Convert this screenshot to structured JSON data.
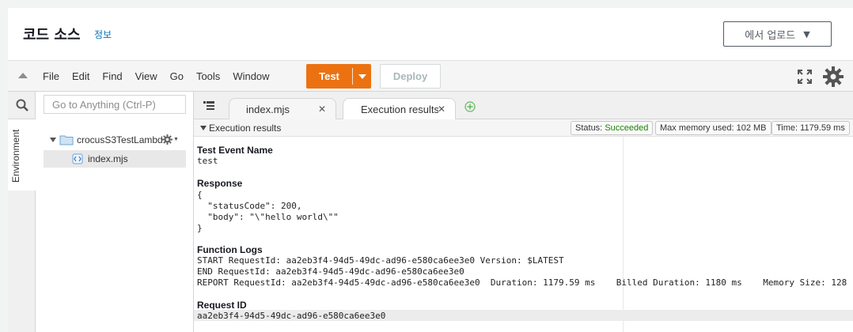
{
  "header": {
    "title": "코드 소스",
    "info_link": "정보",
    "upload_label": "에서 업로드"
  },
  "menubar": {
    "items": [
      "File",
      "Edit",
      "Find",
      "View",
      "Go",
      "Tools",
      "Window"
    ],
    "test_label": "Test",
    "deploy_label": "Deploy"
  },
  "sidebar": {
    "search_placeholder": "Go to Anything (Ctrl-P)",
    "env_tab_label": "Environment",
    "root_folder": "crocusS3TestLambd",
    "file": "index.mjs"
  },
  "tabs": [
    {
      "label": "index.mjs"
    },
    {
      "label": "Execution results"
    }
  ],
  "results_bar": {
    "title": "Execution results",
    "status_label": "Status:",
    "status_value": "Succeeded",
    "memory": "Max memory used: 102 MB",
    "time": "Time: 1179.59 ms"
  },
  "results": {
    "event_heading": "Test Event Name",
    "event_value": "test",
    "response_heading": "Response",
    "response_lines": [
      "{",
      "  \"statusCode\": 200,",
      "  \"body\": \"\\\"hello world\\\"\"",
      "}"
    ],
    "logs_heading": "Function Logs",
    "log_lines": [
      "START RequestId: aa2eb3f4-94d5-49dc-ad96-e580ca6ee3e0 Version: $LATEST",
      "END RequestId: aa2eb3f4-94d5-49dc-ad96-e580ca6ee3e0",
      "REPORT RequestId: aa2eb3f4-94d5-49dc-ad96-e580ca6ee3e0  Duration: 1179.59 ms    Billed Duration: 1180 ms    Memory Size: 128"
    ],
    "request_heading": "Request ID",
    "request_value": "aa2eb3f4-94d5-49dc-ad96-e580ca6ee3e0"
  },
  "colors": {
    "accent_orange": "#ec7211",
    "link_blue": "#0073bb",
    "success_green": "#1d8102"
  }
}
